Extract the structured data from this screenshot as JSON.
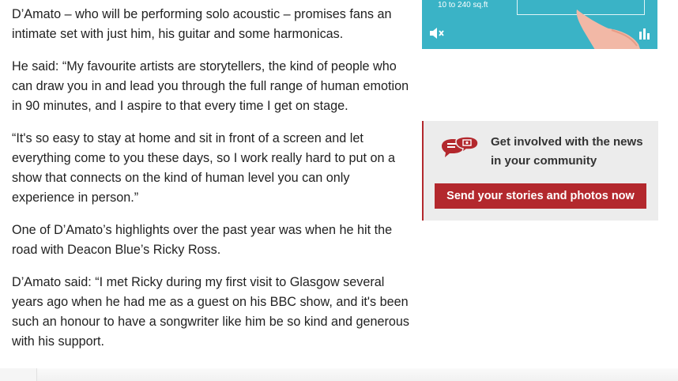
{
  "article": {
    "paragraphs": [
      "D’Amato – who will be performing solo acoustic – promises fans an intimate set with just him, his guitar and some harmonicas.",
      "He said: “My favourite artists are storytellers, the kind of people who can draw you in and lead you through the full range of human emotion in 90 minutes, and I aspire to that every time I get on stage.",
      "“It's so easy to stay at home and sit in front of a screen and let everything come to you these days, so I work really hard to put on a show that connects on the kind of human level you can only experience in person.”",
      "One of D’Amato’s highlights over the past year was when he hit the road with Deacon Blue’s Ricky Ross.",
      "D’Amato said: “I met Ricky during my first visit to Glasgow several years ago when he had me as a guest on his BBC show, and it's been such an honour to have a songwriter like him be so kind and generous with his support."
    ]
  },
  "video_ad": {
    "caption": "10 to 240 sq.ft"
  },
  "promo": {
    "text": "Get involved with the news in your community",
    "button_label": "Send your stories and photos now"
  },
  "colors": {
    "brand_red": "#b3282d",
    "promo_bg": "#ececec",
    "ad_teal": "#3ab3c6"
  }
}
